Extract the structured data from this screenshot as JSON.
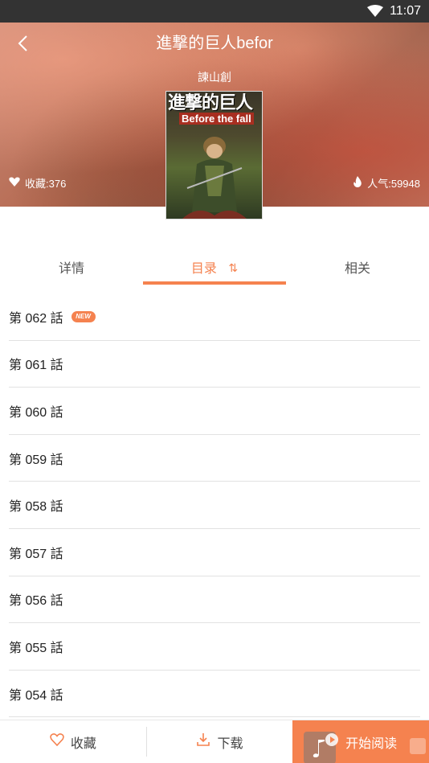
{
  "status_bar": {
    "time": "11:07"
  },
  "header": {
    "title": "進撃的巨人befor",
    "author": "諫山創",
    "favorites": "收藏:376",
    "popularity": "人气:59948"
  },
  "cover": {
    "title_text": "進撃的巨人",
    "subtitle_text": "Before the fall"
  },
  "tabs": [
    {
      "label": "详情"
    },
    {
      "label": "目录",
      "sort_glyph": "⇅"
    },
    {
      "label": "相关"
    }
  ],
  "chapters": [
    {
      "label": "第 062 話",
      "badge": "NEW"
    },
    {
      "label": "第 061 話"
    },
    {
      "label": "第 060 話"
    },
    {
      "label": "第 059 話"
    },
    {
      "label": "第 058 話"
    },
    {
      "label": "第 057 話"
    },
    {
      "label": "第 056 話"
    },
    {
      "label": "第 055 話"
    },
    {
      "label": "第 054 話"
    }
  ],
  "bottom_bar": {
    "favorite_label": "收藏",
    "download_label": "下载",
    "read_label": "开始阅读"
  },
  "colors": {
    "accent": "#f5824f",
    "status_bar": "#333333"
  }
}
